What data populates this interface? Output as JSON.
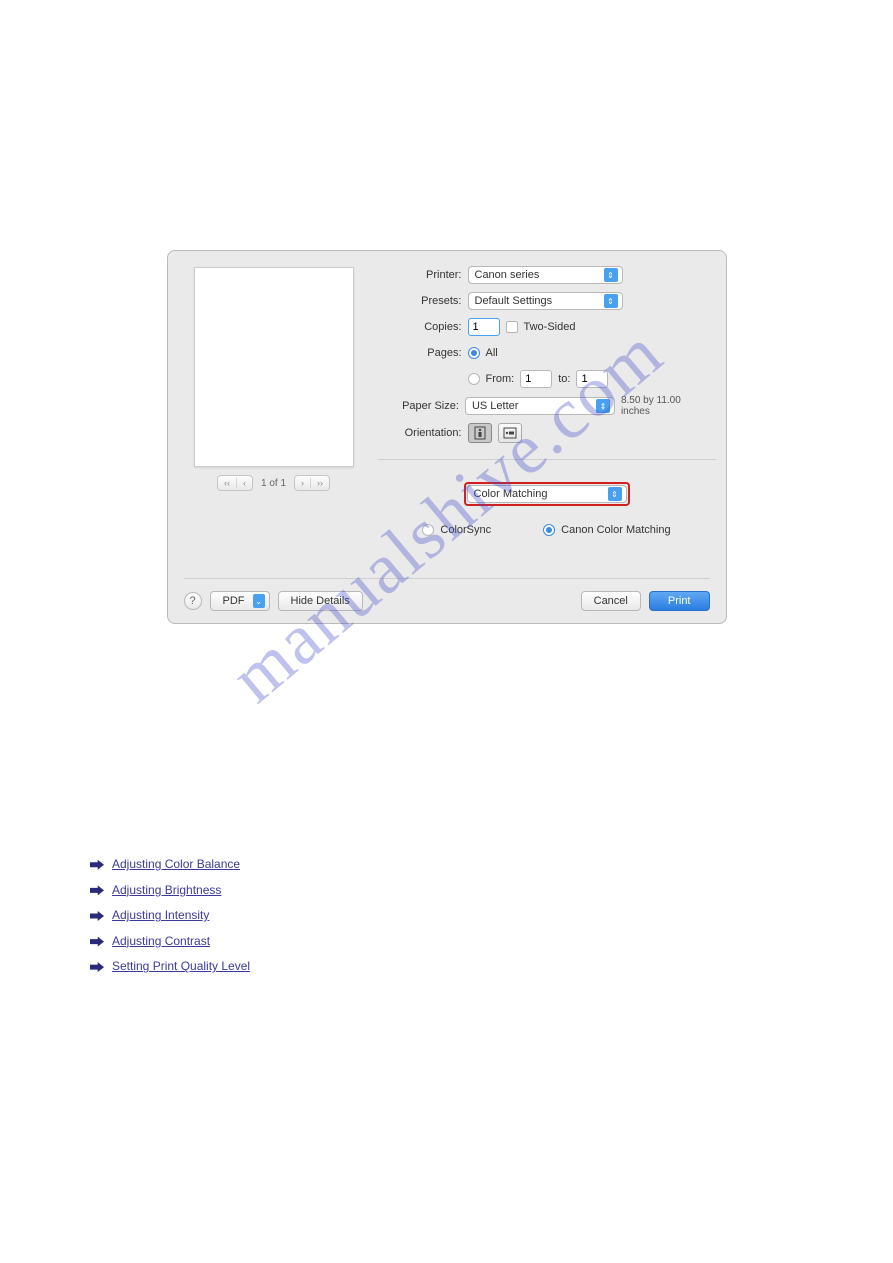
{
  "dialog": {
    "labels": {
      "printer": "Printer:",
      "presets": "Presets:",
      "copies": "Copies:",
      "pages": "Pages:",
      "paper_size": "Paper Size:",
      "orientation": "Orientation:",
      "from": "From:",
      "to": "to:"
    },
    "printer_value": "Canon            series",
    "presets_value": "Default Settings",
    "copies_value": "1",
    "two_sided_label": "Two-Sided",
    "pages_all_label": "All",
    "pages_from_value": "1",
    "pages_to_value": "1",
    "paper_size_value": "US Letter",
    "paper_dims": "8.50 by 11.00 inches",
    "section_select_value": "Color Matching",
    "colorsync_label": "ColorSync",
    "canon_match_label": "Canon Color Matching",
    "preview_page_label": "1 of 1",
    "pdf_label": "PDF",
    "hide_details_label": "Hide Details",
    "cancel_label": "Cancel",
    "print_label": "Print"
  },
  "watermark": "manualshive.com",
  "links": {
    "items": [
      "Adjusting Color Balance",
      "Adjusting Brightness",
      "Adjusting Intensity",
      "Adjusting Contrast",
      "Setting Print Quality Level"
    ]
  }
}
